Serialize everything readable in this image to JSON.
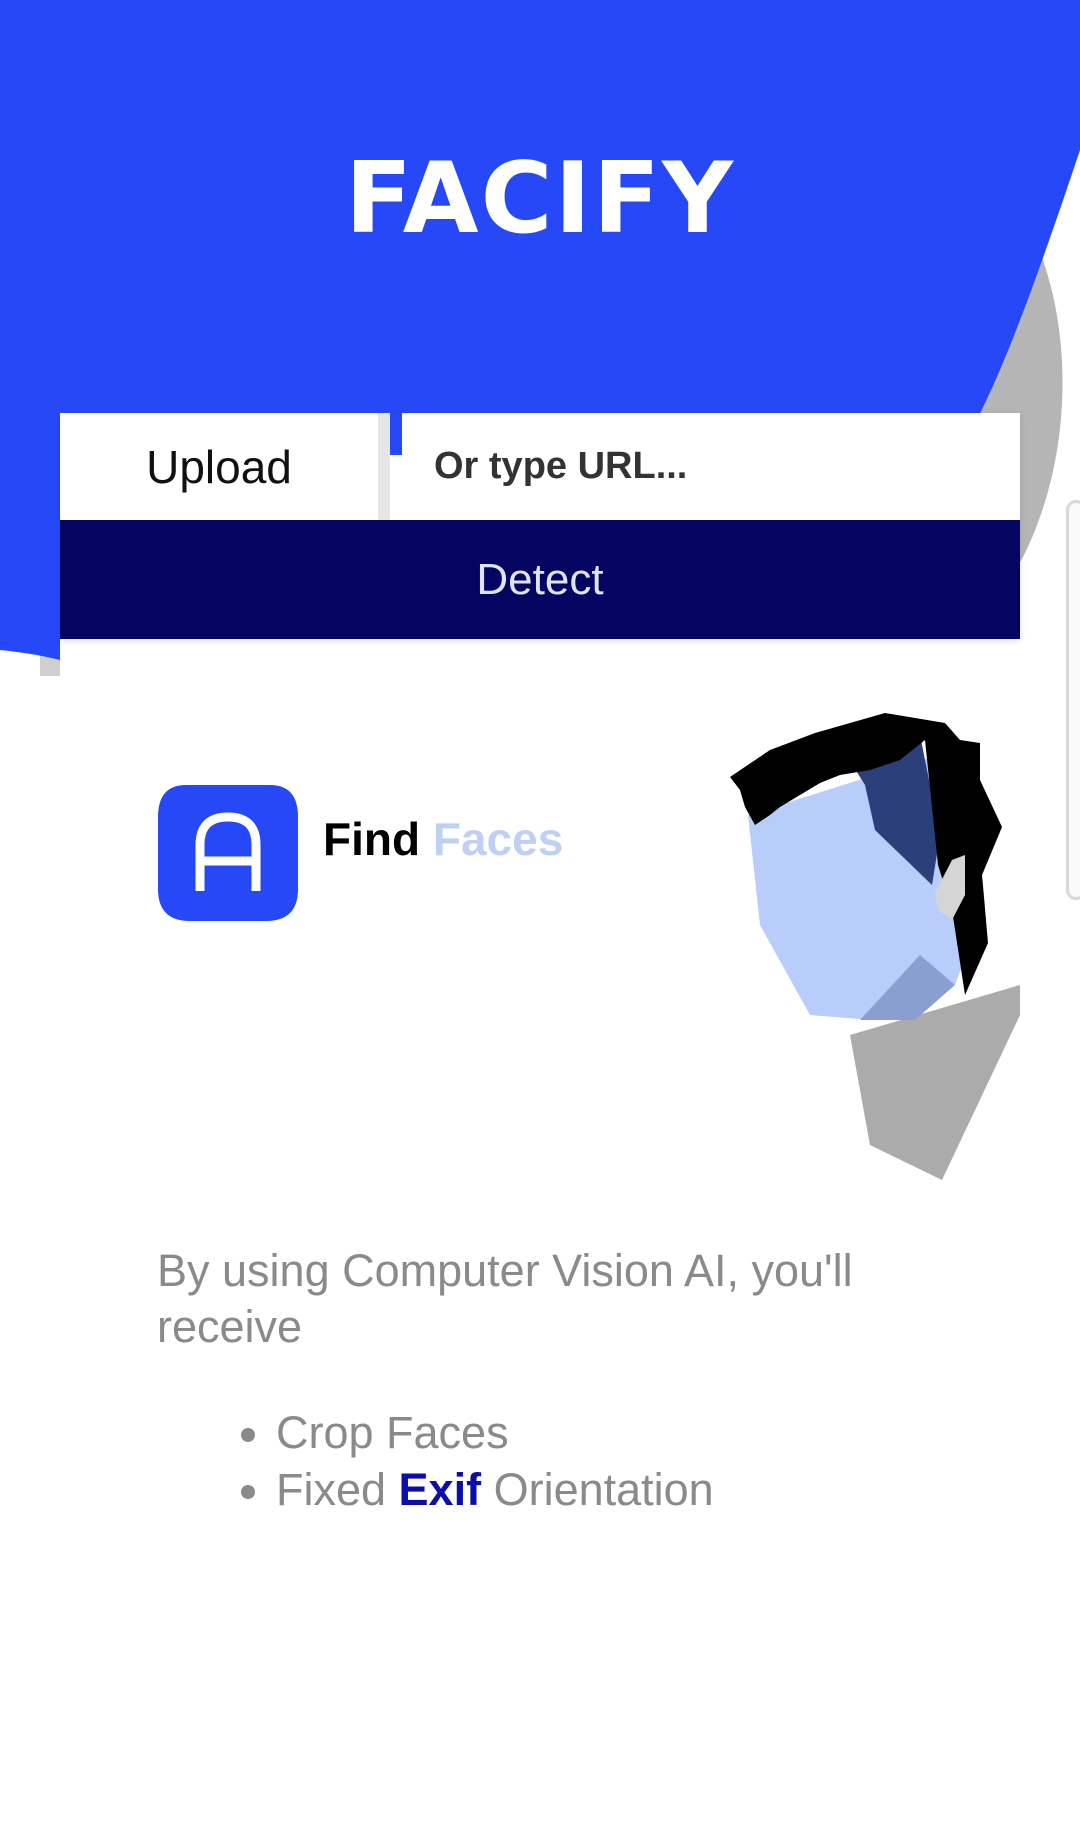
{
  "app": {
    "logo_text": "FACIFY"
  },
  "form": {
    "upload_label": "Upload",
    "url_placeholder": "Or type URL...",
    "detect_label": "Detect"
  },
  "brand": {
    "icon_letter": "A",
    "heading_word_1": "Find",
    "heading_word_2": "Faces"
  },
  "description": {
    "intro": "By using Computer Vision AI, you'll receive",
    "features": [
      {
        "text": "Crop Faces"
      },
      {
        "before": "Fixed ",
        "highlight": "Exif",
        "after": " Orientation"
      }
    ]
  },
  "colors": {
    "primary_blue": "#2748f7",
    "navy": "#030560",
    "faces_light_blue": "#c0d0f3",
    "exif_blue": "#0b0fa8",
    "body_gray": "#8a8a8a"
  },
  "icons": [
    "app-logo-a-icon",
    "face-illustration"
  ]
}
